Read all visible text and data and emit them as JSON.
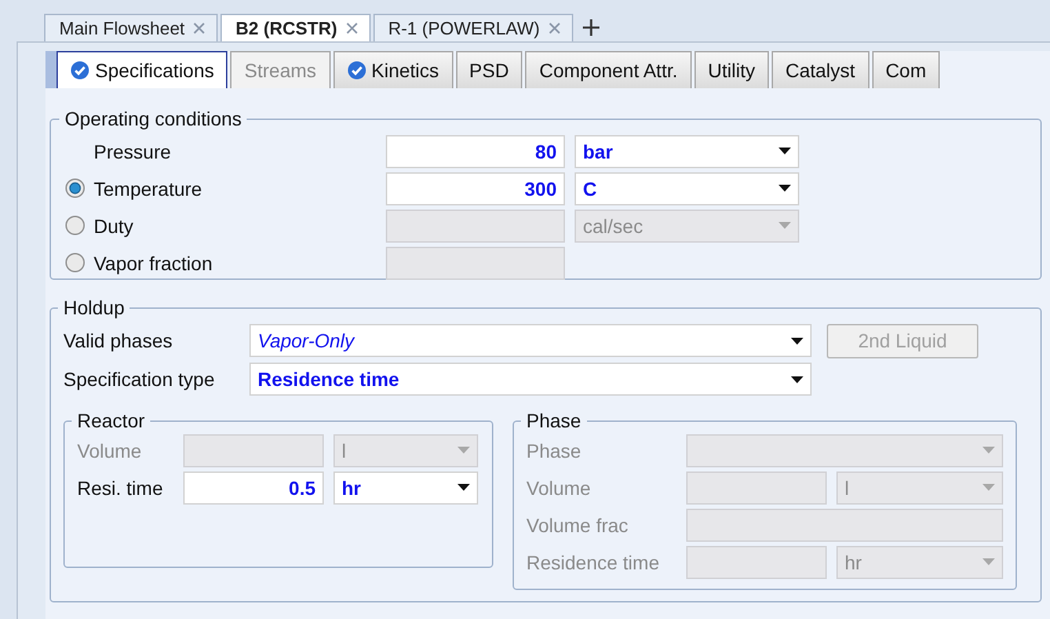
{
  "doc_tabs": [
    {
      "label": "Main Flowsheet",
      "selected": false
    },
    {
      "label": "B2 (RCSTR)",
      "selected": true
    },
    {
      "label": "R-1 (POWERLAW)",
      "selected": false
    }
  ],
  "form_tabs": [
    {
      "label": "Specifications",
      "selected": true,
      "complete": true,
      "disabled": false
    },
    {
      "label": "Streams",
      "selected": false,
      "complete": false,
      "disabled": true
    },
    {
      "label": "Kinetics",
      "selected": false,
      "complete": true,
      "disabled": false
    },
    {
      "label": "PSD",
      "selected": false,
      "complete": false,
      "disabled": false
    },
    {
      "label": "Component Attr.",
      "selected": false,
      "complete": false,
      "disabled": false
    },
    {
      "label": "Utility",
      "selected": false,
      "complete": false,
      "disabled": false
    },
    {
      "label": "Catalyst",
      "selected": false,
      "complete": false,
      "disabled": false
    },
    {
      "label": "Com",
      "selected": false,
      "complete": false,
      "disabled": false
    }
  ],
  "operating_conditions": {
    "title": "Operating conditions",
    "rows": [
      {
        "label": "Pressure",
        "kind": "plain",
        "fields": [
          {
            "kind": "number",
            "value": "80",
            "disabled": false
          },
          {
            "kind": "unit",
            "value": "bar",
            "disabled": false
          }
        ]
      },
      {
        "label": "Temperature",
        "kind": "radio",
        "selected": true,
        "fields": [
          {
            "kind": "number",
            "value": "300",
            "disabled": false
          },
          {
            "kind": "unit",
            "value": "C",
            "disabled": false
          }
        ]
      },
      {
        "label": "Duty",
        "kind": "radio",
        "selected": false,
        "fields": [
          {
            "kind": "number",
            "disabled": true
          },
          {
            "kind": "unit",
            "value": "cal/sec",
            "disabled": true
          }
        ]
      },
      {
        "label": "Vapor fraction",
        "kind": "radio",
        "selected": false,
        "fields": [
          {
            "kind": "number",
            "disabled": true
          }
        ]
      }
    ]
  },
  "holdup": {
    "title": "Holdup",
    "valid_phases": {
      "label": "Valid phases",
      "value": "Vapor-Only",
      "kind": "phase_list"
    },
    "specification_type": {
      "label": "Specification type",
      "value": "Residence time",
      "kind": "spec_list"
    },
    "second_liquid": {
      "label": "2nd Liquid",
      "disabled": true
    },
    "reactor": {
      "title": "Reactor",
      "rows": [
        {
          "label": "Volume",
          "disabled": true,
          "fields": [
            {
              "kind": "number",
              "disabled": true
            },
            {
              "kind": "unit",
              "value": "l",
              "disabled": true
            }
          ]
        },
        {
          "label": "Resi. time",
          "disabled": false,
          "fields": [
            {
              "kind": "number",
              "value": "0.5",
              "disabled": false
            },
            {
              "kind": "unit",
              "value": "hr",
              "disabled": false
            }
          ]
        }
      ]
    },
    "phase": {
      "title": "Phase",
      "rows": [
        {
          "label": "Phase",
          "disabled": true,
          "fields": [
            {
              "kind": "wide_unit",
              "disabled": true
            }
          ]
        },
        {
          "label": "Volume",
          "disabled": true,
          "fields": [
            {
              "kind": "number",
              "disabled": true
            },
            {
              "kind": "unit",
              "value": "l",
              "disabled": true
            }
          ]
        },
        {
          "label": "Volume frac",
          "disabled": true,
          "fields": [
            {
              "kind": "wide_number",
              "disabled": true
            }
          ]
        },
        {
          "label": "Residence time",
          "disabled": true,
          "fields": [
            {
              "kind": "number",
              "disabled": true
            },
            {
              "kind": "unit",
              "value": "hr",
              "disabled": true
            }
          ]
        }
      ]
    }
  }
}
